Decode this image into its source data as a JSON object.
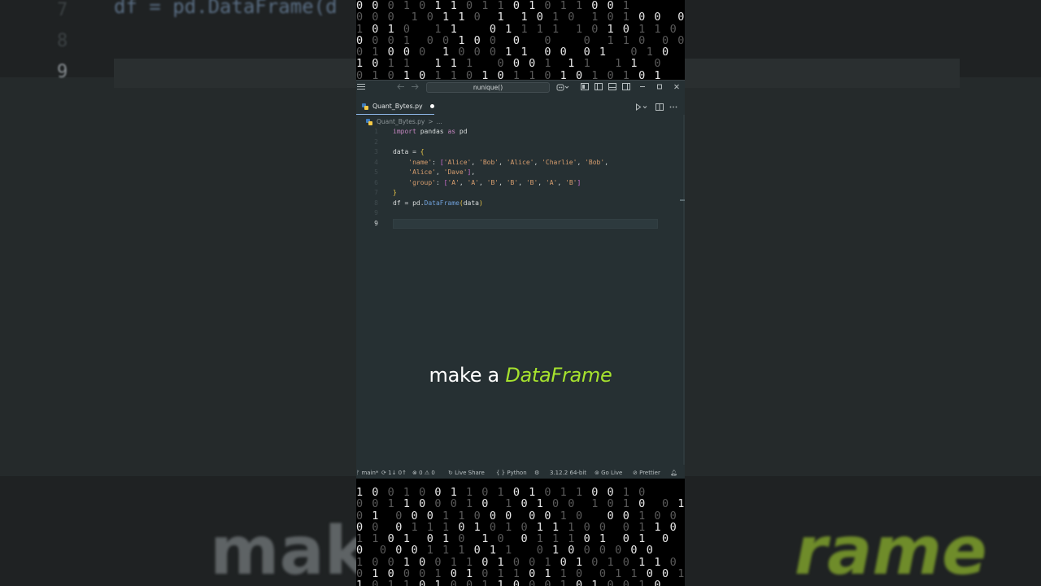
{
  "background": {
    "code_line": "df = pd.DataFrame(d",
    "line_numbers": [
      "7",
      "8",
      "9"
    ],
    "caption_left": "make",
    "caption_right": "rame"
  },
  "binary_top": [
    "0 0 0 1 0 1 1 0 1 1 0 1 0 1 1 0 0 1",
    "0 0 0  1 0 1 1 0  1  1 0 1 0  1 0 1 0 0  0 1",
    "1 0 1 0   1 1    0 1 1 1 1  1 0 1 0 1 1 0 1",
    "0 0 0 1  0 0 1 0 0  0   0    0  1 1 0  0 0",
    "0 1 0 0 0  1 0 0 0 1 1  0 0  0 1   0 1 0  1 1",
    "1 0 1 1   1 1 1   0 0 0 1  1 1   1 1  0",
    "0 1 0 1 0 1 1 0 1 0 1 1 0 1 0 1 0 1 0 1"
  ],
  "binary_bottom": [
    "1 0 0 1 0 0 1 1 0 1 0 1 0 1 1 0 0 1 0",
    "0 0 1 1 0 0 0 1 0  1 0 1 0 0  1 0 1 0  0 1",
    "0 1  0 0 0 1 1 0 0 0  0 0 1 0   0 0 1 0 0 1",
    "0 0  0 1 1 1 0 1 0 1 0 1 1 1 0 0  0 1 1 0 0",
    "1 1 0 1  0 1 0  1 0  0 1 1 1 0 1  0 1  0",
    "0  0 0 0 1 1 1 0 1 1   0 1 0 0 0 0 0 0",
    "1 0 0 1 0 0 1 1 0 1 0 0 1 0 1 0 1 0 1 1 0",
    "0 1 0 0 0 1 0 1 0 1 1 0 1 1 0  0 1 1 0 0 1",
    "1 0 1 1 0 1 0 0 1 1 0 0 0 1 0 1 0 0 1 0"
  ],
  "window": {
    "search_text": "nunique()",
    "tab_label": "Quant_Bytes.py",
    "breadcrumb_file": "Quant_Bytes.py",
    "breadcrumb_sep": ">",
    "breadcrumb_more": "...",
    "lines": [
      {
        "n": "1",
        "code": "import pandas as pd"
      },
      {
        "n": "2",
        "code": ""
      },
      {
        "n": "3",
        "code": "data = {"
      },
      {
        "n": "4",
        "code": "    'name': ['Alice', 'Bob', 'Alice', 'Charlie', 'Bob',"
      },
      {
        "n": "5",
        "code": "    'Alice', 'Dave'],"
      },
      {
        "n": "6",
        "code": "    'group': ['A', 'A', 'B', 'B', 'B', 'A', 'B']"
      },
      {
        "n": "7",
        "code": "}"
      },
      {
        "n": "8",
        "code": "df = pd.DataFrame(data)"
      },
      {
        "n": "9",
        "code": ""
      }
    ],
    "caption_plain": "make a",
    "caption_highlight": "DataFrame"
  },
  "status": {
    "branch": "main*",
    "sync": "1↓ 0↑",
    "errors": "0",
    "warnings": "0",
    "live_share": "Live Share",
    "language": "Python",
    "interpreter": "3.12.2 64-bit",
    "go_live": "Go Live",
    "prettier": "Prettier"
  },
  "colors": {
    "accent_caption": "#a6e22e",
    "editor_bg": "#263033",
    "tab_indicator": "#8fb8e8"
  }
}
